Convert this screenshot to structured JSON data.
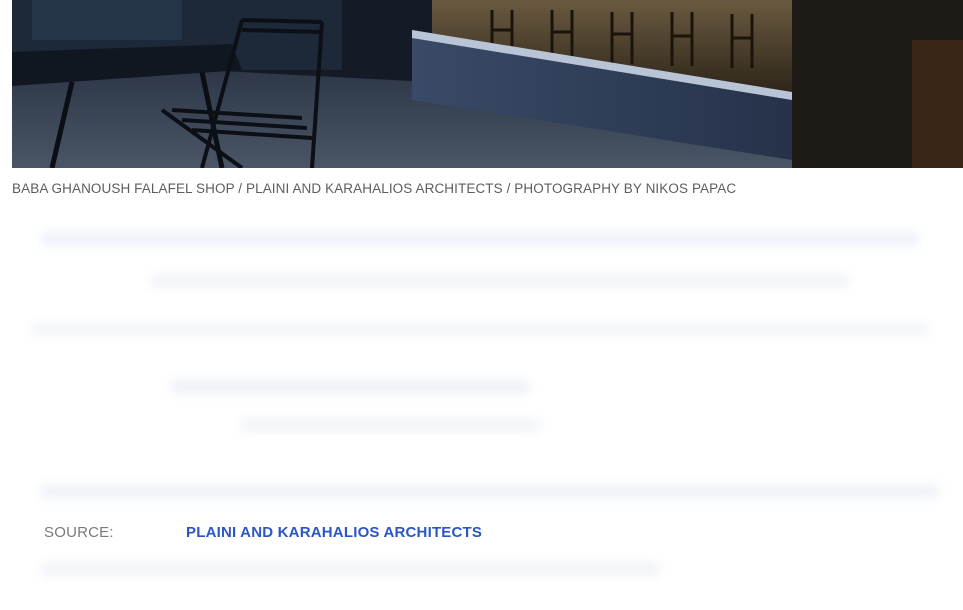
{
  "photo": {
    "alt_icon": "architecture-photo"
  },
  "caption": {
    "text": "BABA GHANOUSH FALAFEL SHOP / PLAINI AND KARAHALIOS ARCHITECTS / PHOTOGRAPHY BY NIKOS PAPAC"
  },
  "source": {
    "label": "SOURCE:",
    "link_text": "PLAINI AND KARAHALIOS ARCHITECTS"
  },
  "colors": {
    "caption_text": "#5d5d5d",
    "source_label": "#7a7a7a",
    "link": "#2a56c6"
  }
}
